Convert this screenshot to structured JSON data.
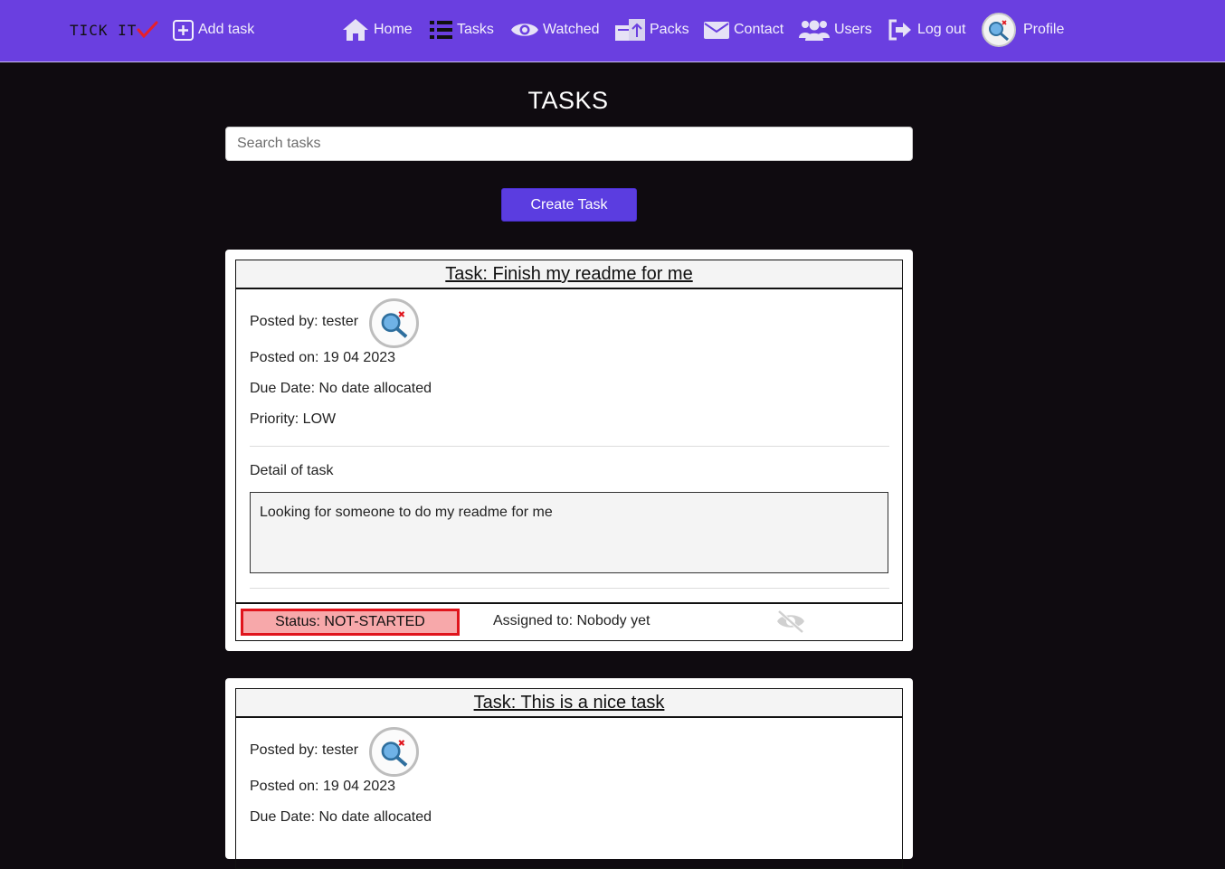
{
  "brand": {
    "text": "TICK IT",
    "check_color": "#e8202a"
  },
  "nav": {
    "add_task": "Add task",
    "home": "Home",
    "tasks": "Tasks",
    "watched": "Watched",
    "packs": "Packs",
    "contact": "Contact",
    "users": "Users",
    "logout": "Log out",
    "profile": "Profile"
  },
  "page": {
    "title": "TASKS",
    "search_placeholder": "Search tasks",
    "create_button": "Create Task"
  },
  "tasks": [
    {
      "title": "Task: Finish my readme for me",
      "posted_by": "Posted by: tester",
      "posted_on": "Posted on: 19 04 2023",
      "due_date": "Due Date: No date allocated",
      "priority": "Priority: LOW",
      "detail_label": "Detail of task",
      "detail": "Looking for someone to do my readme for me",
      "status": "Status: NOT-STARTED",
      "assigned": "Assigned to: Nobody yet"
    },
    {
      "title": "Task: This is a nice task",
      "posted_by": "Posted by: tester",
      "posted_on": "Posted on: 19 04 2023",
      "due_date": "Due Date: No date allocated"
    }
  ],
  "colors": {
    "navbar": "#6a3fe0",
    "background": "#0f0b10",
    "create_button": "#5b3de0",
    "status_border": "#e0141c",
    "status_fill": "#f7a8aa"
  },
  "icons": [
    "add-square-icon",
    "home-icon",
    "list-icon",
    "eye-icon",
    "packs-icon",
    "envelope-icon",
    "users-icon",
    "logout-icon",
    "avatar-icon",
    "eye-slash-icon"
  ]
}
